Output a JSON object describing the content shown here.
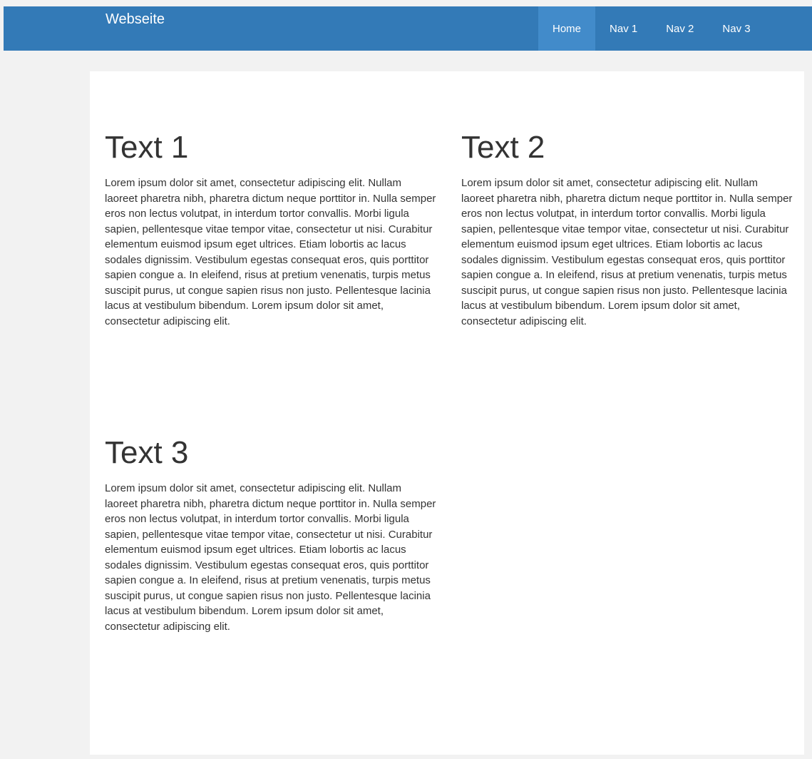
{
  "navbar": {
    "brand": "Webseite",
    "items": [
      {
        "label": "Home",
        "active": true
      },
      {
        "label": "Nav 1",
        "active": false
      },
      {
        "label": "Nav 2",
        "active": false
      },
      {
        "label": "Nav 3",
        "active": false
      }
    ]
  },
  "sections": [
    {
      "title": "Text 1",
      "body": "Lorem ipsum dolor sit amet, consectetur adipiscing elit. Nullam laoreet pharetra nibh, pharetra dictum neque porttitor in. Nulla semper eros non lectus volutpat, in interdum tortor convallis. Morbi ligula sapien, pellentesque vitae tempor vitae, consectetur ut nisi. Curabitur elementum euismod ipsum eget ultrices. Etiam lobortis ac lacus sodales dignissim. Vestibulum egestas consequat eros, quis porttitor sapien congue a. In eleifend, risus at pretium venenatis, turpis metus suscipit purus, ut congue sapien risus non justo. Pellentesque lacinia lacus at vestibulum bibendum. Lorem ipsum dolor sit amet, consectetur adipiscing elit."
    },
    {
      "title": "Text 2",
      "body": "Lorem ipsum dolor sit amet, consectetur adipiscing elit. Nullam laoreet pharetra nibh, pharetra dictum neque porttitor in. Nulla semper eros non lectus volutpat, in interdum tortor convallis. Morbi ligula sapien, pellentesque vitae tempor vitae, consectetur ut nisi. Curabitur elementum euismod ipsum eget ultrices. Etiam lobortis ac lacus sodales dignissim. Vestibulum egestas consequat eros, quis porttitor sapien congue a. In eleifend, risus at pretium venenatis, turpis metus suscipit purus, ut congue sapien risus non justo. Pellentesque lacinia lacus at vestibulum bibendum. Lorem ipsum dolor sit amet, consectetur adipiscing elit."
    },
    {
      "title": "Text 3",
      "body": "Lorem ipsum dolor sit amet, consectetur adipiscing elit. Nullam laoreet pharetra nibh, pharetra dictum neque porttitor in. Nulla semper eros non lectus volutpat, in interdum tortor convallis. Morbi ligula sapien, pellentesque vitae tempor vitae, consectetur ut nisi. Curabitur elementum euismod ipsum eget ultrices. Etiam lobortis ac lacus sodales dignissim. Vestibulum egestas consequat eros, quis porttitor sapien congue a. In eleifend, risus at pretium venenatis, turpis metus suscipit purus, ut congue sapien risus non justo. Pellentesque lacinia lacus at vestibulum bibendum. Lorem ipsum dolor sit amet, consectetur adipiscing elit."
    }
  ],
  "colors": {
    "navbar": "#337ab7",
    "active_nav": "#428bca",
    "page_background": "#f2f2f2",
    "content_background": "#ffffff",
    "text": "#333333"
  }
}
